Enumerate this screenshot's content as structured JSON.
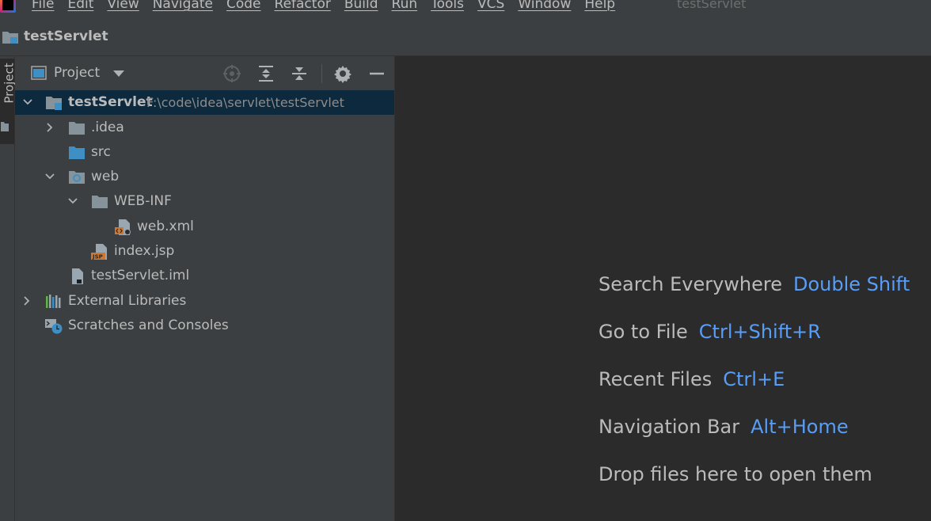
{
  "menu": {
    "items": [
      "File",
      "Edit",
      "View",
      "Navigate",
      "Code",
      "Refactor",
      "Build",
      "Run",
      "Tools",
      "VCS",
      "Window",
      "Help"
    ],
    "window_title": "testServlet"
  },
  "navbar": {
    "project_name": "testServlet"
  },
  "left_stripe": {
    "project_tab_label": "Project"
  },
  "project_panel": {
    "title": "Project",
    "header_icons": [
      "locate-icon",
      "expand-all-icon",
      "collapse-all-icon",
      "gear-icon",
      "minimize-icon"
    ],
    "tree": {
      "root": {
        "name": "testServlet",
        "path": "F:\\code\\idea\\servlet\\testServlet"
      },
      "idea": ".idea",
      "src": "src",
      "web": "web",
      "web_inf": "WEB-INF",
      "web_xml": "web.xml",
      "index_jsp": "index.jsp",
      "iml": "testServlet.iml",
      "external_libraries": "External Libraries",
      "scratches": "Scratches and Consoles"
    }
  },
  "editor_hints": {
    "search": {
      "text": "Search Everywhere",
      "key": "Double Shift"
    },
    "goto_file": {
      "text": "Go to File",
      "key": "Ctrl+Shift+R"
    },
    "recent": {
      "text": "Recent Files",
      "key": "Ctrl+E"
    },
    "navbar": {
      "text": "Navigation Bar",
      "key": "Alt+Home"
    },
    "drop": {
      "text": "Drop files here to open them"
    }
  },
  "colors": {
    "background": "#2b2b2b",
    "panel": "#3c3f41",
    "selection": "#0d293e",
    "shortcut": "#589df6",
    "folder": "#87939a",
    "source_folder": "#3d8fc4"
  }
}
